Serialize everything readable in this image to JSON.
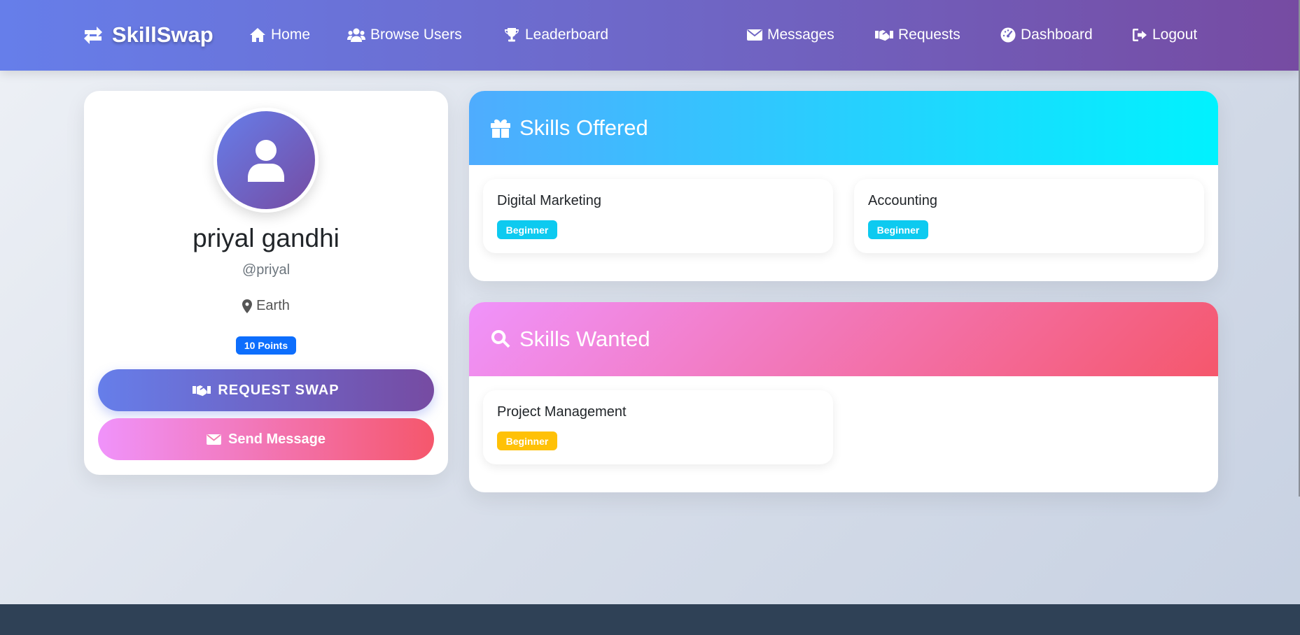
{
  "navbar": {
    "brand": "SkillSwap",
    "links": {
      "home": "Home",
      "browse": "Browse Users",
      "leaderboard": "Leaderboard",
      "messages": "Messages",
      "requests": "Requests",
      "dashboard": "Dashboard",
      "logout": "Logout"
    }
  },
  "profile": {
    "name": "priyal gandhi",
    "username": "@priyal",
    "location": "Earth",
    "points": "10 Points",
    "request_swap": "REQUEST SWAP",
    "send_message": "Send Message"
  },
  "skills_offered": {
    "title": "Skills Offered",
    "items": [
      {
        "name": "Digital Marketing",
        "level": "Beginner"
      },
      {
        "name": "Accounting",
        "level": "Beginner"
      }
    ]
  },
  "skills_wanted": {
    "title": "Skills Wanted",
    "items": [
      {
        "name": "Project Management",
        "level": "Beginner"
      }
    ]
  },
  "colors": {
    "nav_gradient_start": "#667eea",
    "nav_gradient_end": "#764ba2",
    "offered_gradient_start": "#4facfe",
    "offered_gradient_end": "#00f2fe",
    "wanted_gradient_start": "#f093fb",
    "wanted_gradient_end": "#f5576c",
    "points_badge": "#0d6efd",
    "offered_level_badge": "#0dcaf0",
    "wanted_level_badge": "#ffc107",
    "footer": "#2f4156"
  },
  "icons": {
    "brand": "exchange-icon",
    "home": "home-icon",
    "browse": "users-icon",
    "leaderboard": "trophy-icon",
    "messages": "envelope-icon",
    "requests": "handshake-icon",
    "dashboard": "gauge-icon",
    "logout": "sign-out-icon",
    "avatar": "user-icon",
    "location": "map-marker-icon",
    "offered": "gift-icon",
    "wanted": "search-icon"
  }
}
